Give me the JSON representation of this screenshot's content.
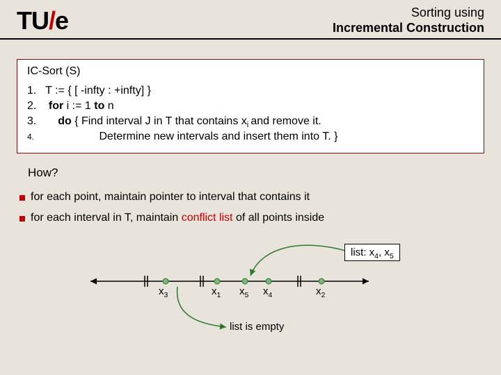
{
  "header": {
    "logo_tu": "TU",
    "logo_slash": "/",
    "logo_e": "e",
    "title_line1": "Sorting using",
    "title_line2": "Incremental Construction"
  },
  "algo": {
    "title": "IC-Sort (S)",
    "line1": {
      "num": "1.",
      "text": "T := {  [ -infty : +infty]  }"
    },
    "line2": {
      "num": "2.",
      "kw": "for",
      "rest_a": " i := 1 ",
      "kw2": "to",
      "rest_b": " n"
    },
    "line3": {
      "num": "3.",
      "kw": "do",
      "rest": "  { Find interval J in T that contains x",
      "sub": "i ",
      "rest2": "and remove it."
    },
    "line4": {
      "num": "4.",
      "rest": "Determine new intervals and insert them into T. }"
    }
  },
  "how": "How?",
  "bullets": {
    "b1": "for each point, maintain pointer to interval that contains it",
    "b2_a": "for each interval in T, maintain ",
    "b2_hl": "conflict list",
    "b2_b": " of all points inside"
  },
  "diagram": {
    "list_label": "list: x",
    "list_s1": "4",
    "list_mid": ", x",
    "list_s2": "5",
    "x3": "x",
    "x3s": "3",
    "x1": "x",
    "x1s": "1",
    "x5": "x",
    "x5s": "5",
    "x4": "x",
    "x4s": "4",
    "x2": "x",
    "x2s": "2",
    "empty": "list is empty"
  }
}
